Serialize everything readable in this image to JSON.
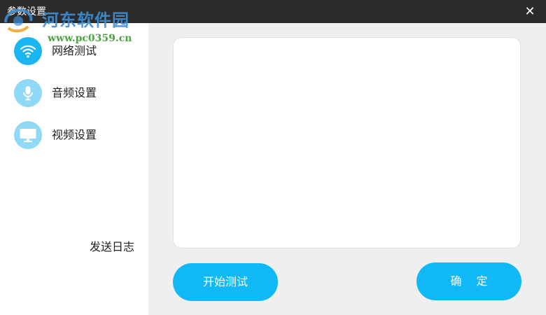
{
  "window": {
    "title": "参数设置",
    "close_icon": "close-icon"
  },
  "watermark": {
    "site_name": "河东软件园",
    "url": "www.pc0359.cn"
  },
  "sidebar": {
    "items": [
      {
        "label": "网络测试",
        "icon": "wifi-icon",
        "active": true
      },
      {
        "label": "音频设置",
        "icon": "microphone-icon",
        "active": false
      },
      {
        "label": "视频设置",
        "icon": "monitor-icon",
        "active": false
      }
    ],
    "send_log_label": "发送日志"
  },
  "main": {
    "start_test_label": "开始测试",
    "confirm_label": "确 定"
  },
  "colors": {
    "titlebar": "#2b2b2b",
    "accent": "#10b8f6",
    "icon_inactive": "#8fd9f7",
    "content_bg": "#efefef"
  }
}
